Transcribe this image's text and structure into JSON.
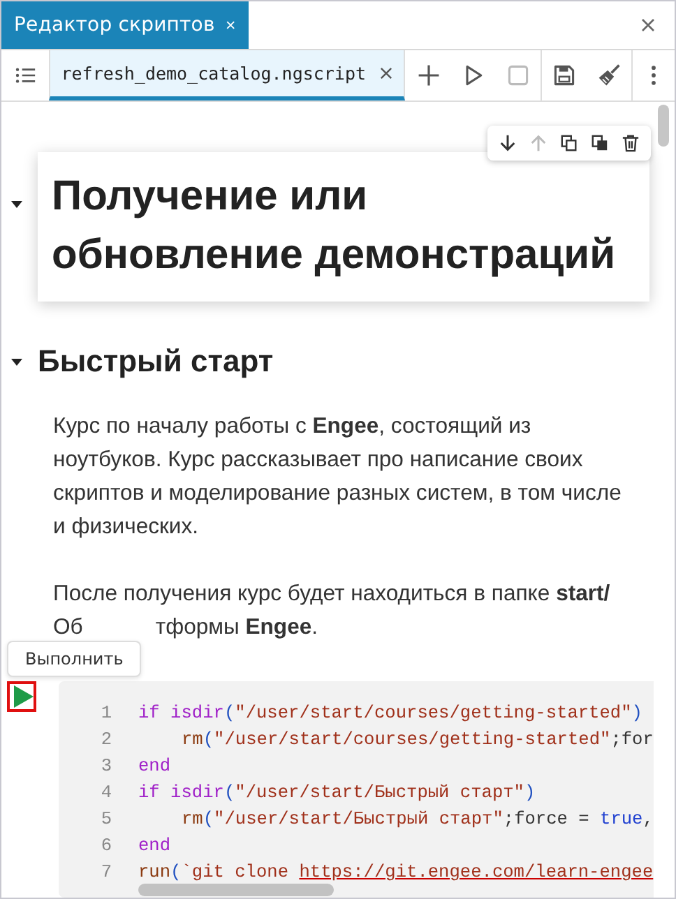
{
  "window": {
    "title": "Редактор скриптов"
  },
  "tabs": [
    {
      "label": "refresh_demo_catalog.ngscript",
      "selected": true
    }
  ],
  "toolbar": {
    "stop_disabled": true
  },
  "cell_toolbar": {
    "move_up_disabled": true
  },
  "heading_1": {
    "text": "Получение или обновление демонстраций",
    "expanded": true
  },
  "heading_2": {
    "text": "Быстрый старт",
    "expanded": true
  },
  "paragraph_1": "Курс по началу работы с **Engee**, состоящий из ноутбуков. Курс рассказывает про написание своих скриптов и моделирование разных систем, в том числе и физических.",
  "paragraph_2": {
    "line_1": "После получения курс будет находиться в папке **start/**",
    "line_2_start": "Об",
    "line_2_end": "тформы **Engee**."
  },
  "tooltip": "Выполнить",
  "code": {
    "lines": [
      {
        "number": "1",
        "tokens": [
          {
            "kind": "keyword",
            "text": "if "
          },
          {
            "kind": "keyword",
            "text": "isdir"
          },
          {
            "kind": "punct",
            "text": "("
          },
          {
            "kind": "string",
            "text": "\"/user/start/courses/getting-started\""
          },
          {
            "kind": "punct",
            "text": ")"
          }
        ]
      },
      {
        "number": "2",
        "indent": true,
        "tokens": [
          {
            "kind": "func",
            "text": "rm"
          },
          {
            "kind": "punct",
            "text": "("
          },
          {
            "kind": "string",
            "text": "\"/user/start/courses/getting-started\""
          },
          {
            "kind": "plain",
            "text": ";for"
          }
        ]
      },
      {
        "number": "3",
        "tokens": [
          {
            "kind": "keyword",
            "text": "end"
          }
        ]
      },
      {
        "number": "4",
        "tokens": [
          {
            "kind": "keyword",
            "text": "if "
          },
          {
            "kind": "keyword",
            "text": "isdir"
          },
          {
            "kind": "punct",
            "text": "("
          },
          {
            "kind": "string",
            "text": "\"/user/start/Быстрый старт\""
          },
          {
            "kind": "punct",
            "text": ")"
          }
        ]
      },
      {
        "number": "5",
        "indent": true,
        "tokens": [
          {
            "kind": "func",
            "text": "rm"
          },
          {
            "kind": "punct",
            "text": "("
          },
          {
            "kind": "string",
            "text": "\"/user/start/Быстрый старт\""
          },
          {
            "kind": "plain",
            "text": ";force = "
          },
          {
            "kind": "literal",
            "text": "true"
          },
          {
            "kind": "plain",
            "text": ","
          }
        ]
      },
      {
        "number": "6",
        "tokens": [
          {
            "kind": "keyword",
            "text": "end"
          }
        ]
      },
      {
        "number": "7",
        "tokens": [
          {
            "kind": "func",
            "text": "run"
          },
          {
            "kind": "punct",
            "text": "("
          },
          {
            "kind": "string",
            "text": "`git clone "
          },
          {
            "kind": "link",
            "text": "https://git.engee.com/learn-engee"
          }
        ]
      }
    ]
  }
}
